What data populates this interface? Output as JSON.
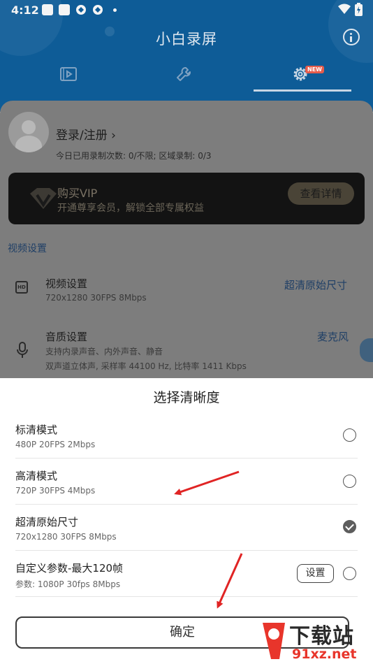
{
  "status_bar": {
    "time": "4:12"
  },
  "app": {
    "title": "小白录屏",
    "new_badge": "NEW"
  },
  "user": {
    "login_label": "登录/注册 ›",
    "usage_text": "今日已用录制次数: 0/不限; 区域录制: 0/3"
  },
  "vip": {
    "title": "购买VIP",
    "subtitle": "开通尊享会员，解锁全部专属权益",
    "button": "查看详情"
  },
  "video_section": {
    "header": "视频设置",
    "video_row": {
      "title": "视频设置",
      "sub": "720x1280  30FPS  8Mbps",
      "value": "超清原始尺寸"
    },
    "audio_row": {
      "title": "音质设置",
      "sub1": "支持内录声音、内外声音、静音",
      "sub2": "双声道立体声, 采样率 44100 Hz, 比特率 1411 Kbps",
      "value": "麦克风"
    }
  },
  "sheet": {
    "title": "选择清晰度",
    "options": [
      {
        "title": "标清模式",
        "sub": "480P  20FPS  2Mbps",
        "checked": false
      },
      {
        "title": "高清模式",
        "sub": "720P  30FPS  4Mbps",
        "checked": false
      },
      {
        "title": "超清原始尺寸",
        "sub": "720x1280  30FPS  8Mbps",
        "checked": true
      },
      {
        "title": "自定义参数-最大120帧",
        "sub": "参数: 1080P 30fps 8Mbps",
        "checked": false
      }
    ],
    "settings_button": "设置",
    "confirm_button": "确定"
  },
  "watermark": {
    "brand": "下载站",
    "domain": "91xz.net"
  },
  "colors": {
    "header_blue": "#0e5c97",
    "annotation_arrow": "#e02424",
    "checked_radio": "#5d5d5d"
  }
}
